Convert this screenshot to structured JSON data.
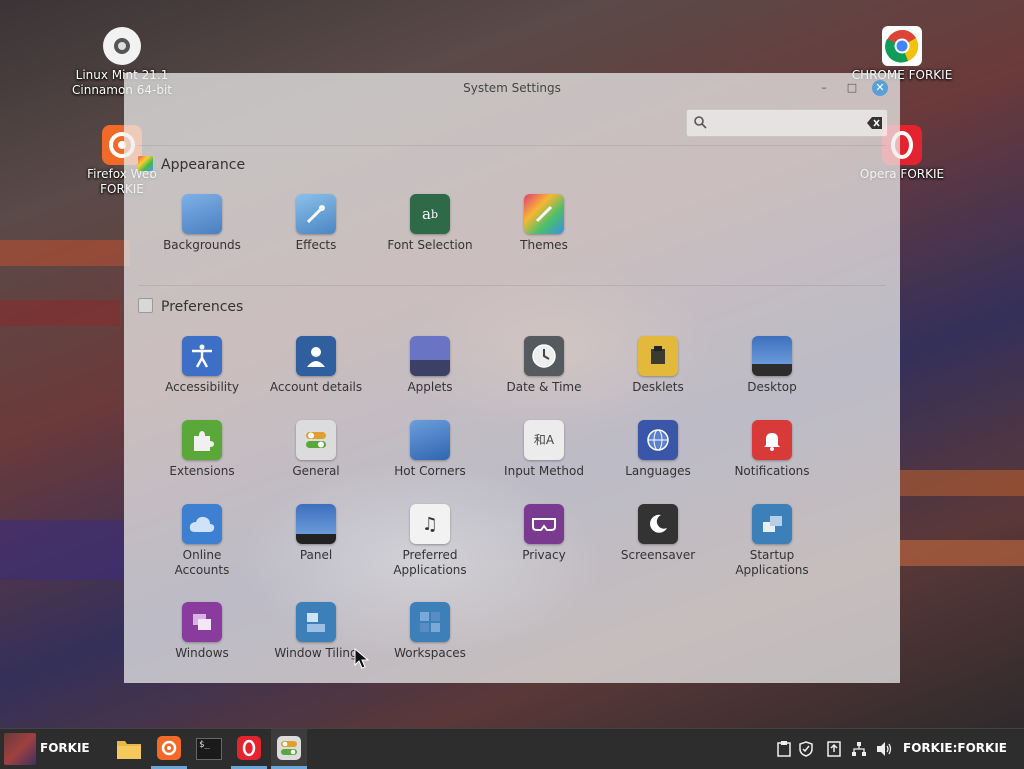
{
  "desktop_icons": {
    "mint": {
      "line1": "Linux Mint 21.1",
      "line2": "Cinnamon 64-bit"
    },
    "firefox": {
      "line1": "Firefox Web",
      "line2": "FORKIE"
    },
    "chrome": {
      "label": "CHROME FORKIE"
    },
    "opera": {
      "label": "Opera FORKIE"
    }
  },
  "window": {
    "title": "System Settings",
    "search": {
      "value": "",
      "placeholder": ""
    }
  },
  "sections": {
    "appearance": {
      "title": "Appearance",
      "items": [
        {
          "label": "Backgrounds",
          "icon": "backgrounds-icon"
        },
        {
          "label": "Effects",
          "icon": "effects-icon"
        },
        {
          "label": "Font Selection",
          "icon": "font-selection-icon"
        },
        {
          "label": "Themes",
          "icon": "themes-icon"
        }
      ]
    },
    "preferences": {
      "title": "Preferences",
      "items": [
        {
          "label": "Accessibility",
          "icon": "accessibility-icon"
        },
        {
          "label": "Account details",
          "icon": "account-details-icon"
        },
        {
          "label": "Applets",
          "icon": "applets-icon"
        },
        {
          "label": "Date & Time",
          "icon": "clock-icon"
        },
        {
          "label": "Desklets",
          "icon": "desklets-icon"
        },
        {
          "label": "Desktop",
          "icon": "desktop-icon"
        },
        {
          "label": "Extensions",
          "icon": "puzzle-icon"
        },
        {
          "label": "General",
          "icon": "toggle-icon"
        },
        {
          "label": "Hot Corners",
          "icon": "hot-corners-icon"
        },
        {
          "label": "Input Method",
          "icon": "input-method-icon"
        },
        {
          "label": "Languages",
          "icon": "globe-icon"
        },
        {
          "label": "Notifications",
          "icon": "bell-icon"
        },
        {
          "line1": "Online",
          "line2": "Accounts",
          "icon": "cloud-icon"
        },
        {
          "label": "Panel",
          "icon": "panel-icon"
        },
        {
          "line1": "Preferred",
          "line2": "Applications",
          "icon": "music-video-icon"
        },
        {
          "label": "Privacy",
          "icon": "mask-icon"
        },
        {
          "label": "Screensaver",
          "icon": "moon-icon"
        },
        {
          "line1": "Startup",
          "line2": "Applications",
          "icon": "startup-icon"
        },
        {
          "label": "Windows",
          "icon": "windows-icon"
        },
        {
          "label": "Window Tiling",
          "icon": "window-tiling-icon"
        },
        {
          "label": "Workspaces",
          "icon": "workspaces-icon"
        }
      ]
    }
  },
  "taskbar": {
    "menu_label": "FORKIE",
    "user_label": "FORKIE:FORKIE",
    "apps": [
      "file-manager-icon",
      "firefox-icon",
      "terminal-icon",
      "opera-icon",
      "system-settings-icon"
    ]
  },
  "colors": {
    "accent": "#5aa0d8",
    "taskbar": "#2d2d2d"
  }
}
